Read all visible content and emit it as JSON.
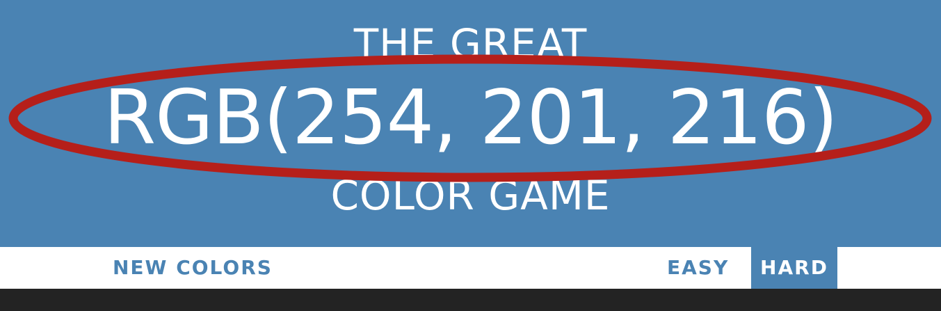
{
  "header": {
    "title_top": "THE GREAT",
    "rgb_display": "RGB(254, 201, 216)",
    "title_bottom": "COLOR GAME",
    "background_color": "#4a83b3"
  },
  "annotation": {
    "shape": "ellipse",
    "color": "#b51f1a"
  },
  "stripe": {
    "new_colors_label": "NEW COLORS",
    "message": "",
    "easy_label": "EASY",
    "hard_label": "HARD",
    "selected_mode": "HARD"
  },
  "board": {
    "background_color": "#232323"
  }
}
